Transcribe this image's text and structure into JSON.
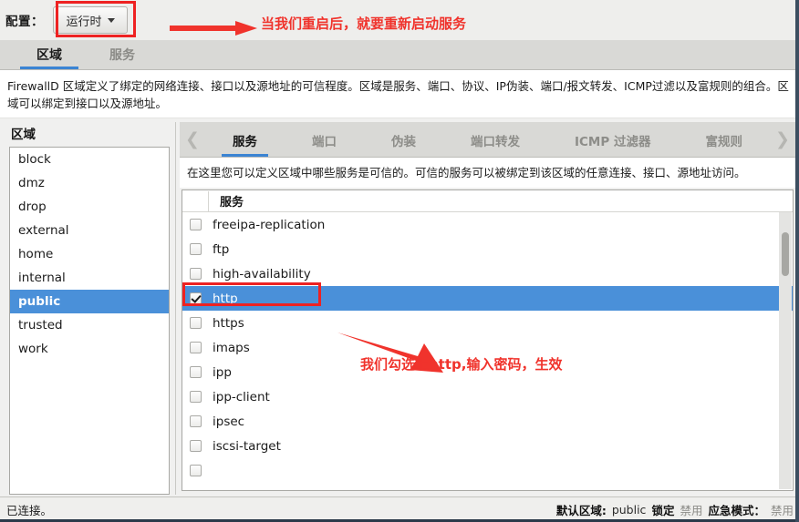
{
  "config_bar": {
    "label": "配置：",
    "selected": "运行时",
    "caret_icon": "chevron-down-icon"
  },
  "annotations": [
    {
      "id": "note-restart",
      "text": "当我们重启后，就要重新启动服务",
      "color": "#f0332c"
    },
    {
      "id": "note-http",
      "text": "我们勾选上http,输入密码，生效",
      "color": "#f0332c"
    }
  ],
  "outer_tabs": [
    {
      "label": "区域",
      "active": true
    },
    {
      "label": "服务",
      "active": false
    }
  ],
  "description": "FirewallD 区域定义了绑定的网络连接、接口以及源地址的可信程度。区域是服务、端口、协议、IP伪装、端口/报文转发、ICMP过滤以及富规则的组合。区域可以绑定到接口以及源地址。",
  "zone_panel": {
    "title": "区域",
    "items": [
      {
        "label": "block",
        "selected": false
      },
      {
        "label": "dmz",
        "selected": false
      },
      {
        "label": "drop",
        "selected": false
      },
      {
        "label": "external",
        "selected": false
      },
      {
        "label": "home",
        "selected": false
      },
      {
        "label": "internal",
        "selected": false
      },
      {
        "label": "public",
        "selected": true
      },
      {
        "label": "trusted",
        "selected": false
      },
      {
        "label": "work",
        "selected": false
      }
    ]
  },
  "inner_tabs": {
    "prev_icon": "chevron-left-icon",
    "next_icon": "chevron-right-icon",
    "items": [
      {
        "label": "服务",
        "active": true
      },
      {
        "label": "端口",
        "active": false
      },
      {
        "label": "伪装",
        "active": false
      },
      {
        "label": "端口转发",
        "active": false
      },
      {
        "label": "ICMP 过滤器",
        "active": false
      },
      {
        "label": "富规则",
        "active": false
      }
    ]
  },
  "panel_description": "在这里您可以定义区域中哪些服务是可信的。可信的服务可以被绑定到该区域的任意连接、接口、源地址访问。",
  "service_list": {
    "header": "服务",
    "rows": [
      {
        "name": "freeipa-replication",
        "checked": false,
        "selected": false
      },
      {
        "name": "ftp",
        "checked": false,
        "selected": false
      },
      {
        "name": "high-availability",
        "checked": false,
        "selected": false
      },
      {
        "name": "http",
        "checked": true,
        "selected": true
      },
      {
        "name": "https",
        "checked": false,
        "selected": false
      },
      {
        "name": "imaps",
        "checked": false,
        "selected": false
      },
      {
        "name": "ipp",
        "checked": false,
        "selected": false
      },
      {
        "name": "ipp-client",
        "checked": false,
        "selected": false
      },
      {
        "name": "ipsec",
        "checked": false,
        "selected": false
      },
      {
        "name": "iscsi-target",
        "checked": false,
        "selected": false
      },
      {
        "name": "",
        "checked": false,
        "selected": false
      }
    ]
  },
  "status_bar": {
    "connection": "已连接。",
    "default_zone_label": "默认区域:",
    "default_zone_value": "public",
    "lockdown_label": "锁定",
    "lockdown_value": "禁用",
    "panic_label": "应急模式：",
    "panic_value": "禁用"
  },
  "colors": {
    "selection": "#4a90d9",
    "accent_underline": "#3b84d3",
    "annotation_red": "#f0332c",
    "highlight_box": "#ee2222"
  }
}
